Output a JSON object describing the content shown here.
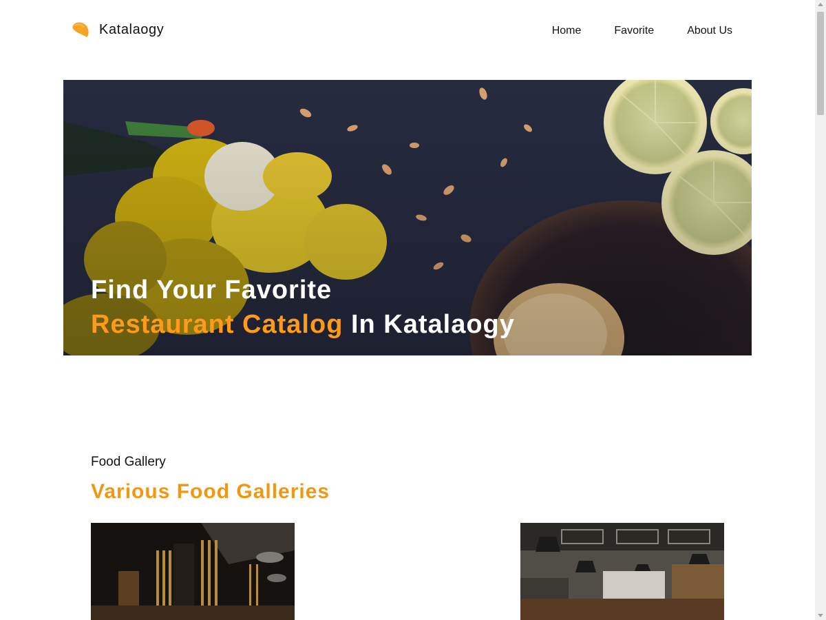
{
  "brand": {
    "name": "Katalaogy",
    "logo_icon": "orange-blob-logo",
    "accent": "#f7a325"
  },
  "nav": {
    "items": [
      {
        "label": "Home"
      },
      {
        "label": "Favorite"
      },
      {
        "label": "About Us"
      }
    ]
  },
  "hero": {
    "line1": "Find Your Favorite",
    "line2_accent": "Restaurant Catalog",
    "line2_rest": " In Katalaogy",
    "image": "dark table with daffodils, lemon slices and almond pastry",
    "accent_color": "#ff9a1a"
  },
  "gallery": {
    "kicker": "Food Gallery",
    "title": "Various Food Galleries",
    "cards": [
      {
        "image": "dark restaurant interior with gold wood panels"
      },
      {
        "image": "industrial cafe interior with pendant lamps"
      }
    ]
  }
}
